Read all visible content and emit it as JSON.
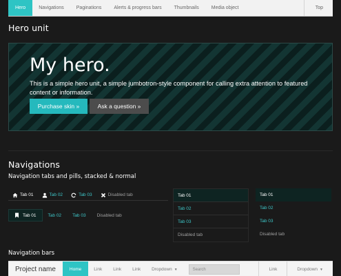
{
  "topnav": {
    "items": [
      "Hero",
      "Navigations",
      "Paginations",
      "Alerts & progress bars",
      "Thumbnails",
      "Media object"
    ],
    "top_label": "Top"
  },
  "hero_section": {
    "heading": "Hero unit",
    "title": "My hero.",
    "text": "This is a simple hero unit, a simple jumbotron-style component for calling extra attention to featured content or information.",
    "primary_button": "Purchase skin »",
    "secondary_button": "Ask a question »"
  },
  "navigations_section": {
    "heading": "Navigations",
    "subheading": "Navigation tabs and pills, stacked & normal",
    "tabs": [
      {
        "label": "Tab 01",
        "icon": "home-icon",
        "state": "active"
      },
      {
        "label": "Tab 02",
        "icon": "user-icon",
        "state": "link"
      },
      {
        "label": "Tab 03",
        "icon": "refresh-icon",
        "state": "link"
      },
      {
        "label": "Disabled tab",
        "icon": "close-icon",
        "state": "disabled"
      }
    ],
    "pills": [
      {
        "label": "Tab 01",
        "icon": "bookmark-icon",
        "state": "active"
      },
      {
        "label": "Tab 02",
        "state": "link"
      },
      {
        "label": "Tab 03",
        "state": "link"
      },
      {
        "label": "Disabled tab",
        "state": "disabled"
      }
    ],
    "stacked_tabs": [
      {
        "label": "Tab 01",
        "state": "active"
      },
      {
        "label": "Tab 02",
        "state": "link"
      },
      {
        "label": "Tab 03",
        "state": "link"
      },
      {
        "label": "Disabled tab",
        "state": "disabled"
      }
    ],
    "stacked_pills": [
      {
        "label": "Tab 01",
        "state": "active"
      },
      {
        "label": "Tab 02",
        "state": "link"
      },
      {
        "label": "Tab 03",
        "state": "link"
      },
      {
        "label": "Disabled tab",
        "state": "disabled"
      }
    ]
  },
  "navbars_section": {
    "subheading": "Navigation bars",
    "navbar": {
      "brand": "Project name",
      "home": "Home",
      "links": [
        "Link",
        "Link",
        "Link"
      ],
      "dropdown": "Dropdown",
      "search_placeholder": "Search",
      "right_link": "Link",
      "right_dropdown": "Dropdown"
    }
  },
  "colors": {
    "accent": "#2ec4c4",
    "link": "#3ec7c9",
    "background": "#1a1a1a"
  }
}
